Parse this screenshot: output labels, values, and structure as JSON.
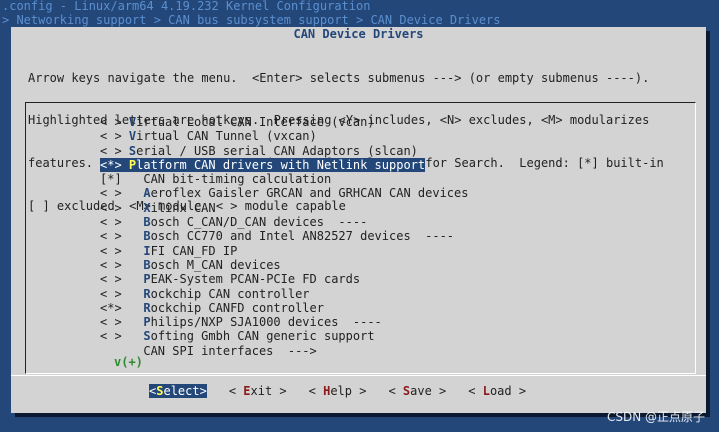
{
  "title_bar": {
    "line1": ".config - Linux/arm64 4.19.232 Kernel Configuration",
    "breadcrumb": "> Networking support > CAN bus subsystem support > CAN Device Drivers"
  },
  "dialog": {
    "title": "CAN Device Drivers",
    "help_lines": [
      "Arrow keys navigate the menu.  <Enter> selects submenus ---> (or empty submenus ----).",
      "Highlighted letters are hotkeys.  Pressing <Y> includes, <N> excludes, <M> modularizes",
      "features.  Press <Esc><Esc> to exit, <?> for Help, </> for Search.  Legend: [*] built-in",
      "[ ] excluded  <M> module  < > module capable"
    ]
  },
  "menu": {
    "items": [
      {
        "sel": "< >",
        "pre": "",
        "hk": "V",
        "rest": "irtual Local CAN Interface (vcan)"
      },
      {
        "sel": "< >",
        "pre": "",
        "hk": "V",
        "rest": "irtual CAN Tunnel (vxcan)"
      },
      {
        "sel": "< >",
        "pre": "",
        "hk": "S",
        "rest": "erial / USB serial CAN Adaptors (slcan)"
      },
      {
        "sel": "<*>",
        "pre": "",
        "hk": "P",
        "rest": "latform CAN drivers with Netlink support"
      },
      {
        "sel": "[*]",
        "pre": "  CAN bit-timing calculation",
        "hk": "",
        "rest": ""
      },
      {
        "sel": "< >",
        "pre": "  ",
        "hk": "A",
        "rest": "eroflex Gaisler GRCAN and GRHCAN CAN devices"
      },
      {
        "sel": "< >",
        "pre": "  ",
        "hk": "X",
        "rest": "ilinx CAN"
      },
      {
        "sel": "< >",
        "pre": "  ",
        "hk": "B",
        "rest": "osch C_CAN/D_CAN devices  ----"
      },
      {
        "sel": "< >",
        "pre": "  ",
        "hk": "B",
        "rest": "osch CC770 and Intel AN82527 devices  ----"
      },
      {
        "sel": "< >",
        "pre": "  ",
        "hk": "I",
        "rest": "FI CAN_FD IP"
      },
      {
        "sel": "< >",
        "pre": "  ",
        "hk": "B",
        "rest": "osch M_CAN devices"
      },
      {
        "sel": "< >",
        "pre": "  ",
        "hk": "P",
        "rest": "EAK-System PCAN-PCIe FD cards"
      },
      {
        "sel": "< >",
        "pre": "  ",
        "hk": "R",
        "rest": "ockchip CAN controller"
      },
      {
        "sel": "<*>",
        "pre": "  ",
        "hk": "R",
        "rest": "ockchip CANFD controller"
      },
      {
        "sel": "< >",
        "pre": "  ",
        "hk": "P",
        "rest": "hilips/NXP SJA1000 devices  ----"
      },
      {
        "sel": "< >",
        "pre": "  ",
        "hk": "S",
        "rest": "ofting Gmbh CAN generic support"
      },
      {
        "sel": "   ",
        "pre": "  CAN SPI interfaces  --->",
        "hk": "",
        "rest": ""
      }
    ],
    "more_indicator": "v(+)"
  },
  "buttons": [
    {
      "pre": "<",
      "hk": "S",
      "rest": "elect>"
    },
    {
      "pre": "< ",
      "hk": "E",
      "rest": "xit >"
    },
    {
      "pre": "< ",
      "hk": "H",
      "rest": "elp >"
    },
    {
      "pre": "< ",
      "hk": "S",
      "rest": "ave >"
    },
    {
      "pre": "< ",
      "hk": "L",
      "rest": "oad >"
    }
  ],
  "watermark": "CSDN @正点原子"
}
